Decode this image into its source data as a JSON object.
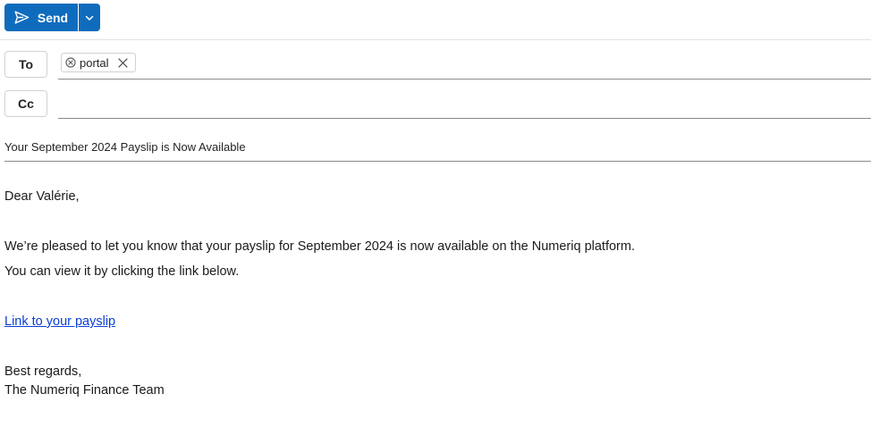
{
  "toolbar": {
    "send_label": "Send",
    "send_icon": "paper-plane-icon",
    "dropdown_icon": "chevron-down-icon",
    "accent_color": "#0f6cbd"
  },
  "to": {
    "label": "To",
    "recipients": [
      {
        "name": "portal",
        "status_icon": "circle-x-icon",
        "remove_icon": "close-icon"
      }
    ]
  },
  "cc": {
    "label": "Cc",
    "value": ""
  },
  "subject": {
    "value": "Your September 2024 Payslip is Now Available"
  },
  "body": {
    "greeting": "Dear Valérie,",
    "paragraph_1": "We’re pleased to let you know that your payslip for September 2024 is now available on the Numeriq platform.",
    "paragraph_2": "You can view it by clicking the link below.",
    "link_text": "Link to your payslip",
    "closing": "Best regards,",
    "signature": "The Numeriq Finance Team"
  }
}
